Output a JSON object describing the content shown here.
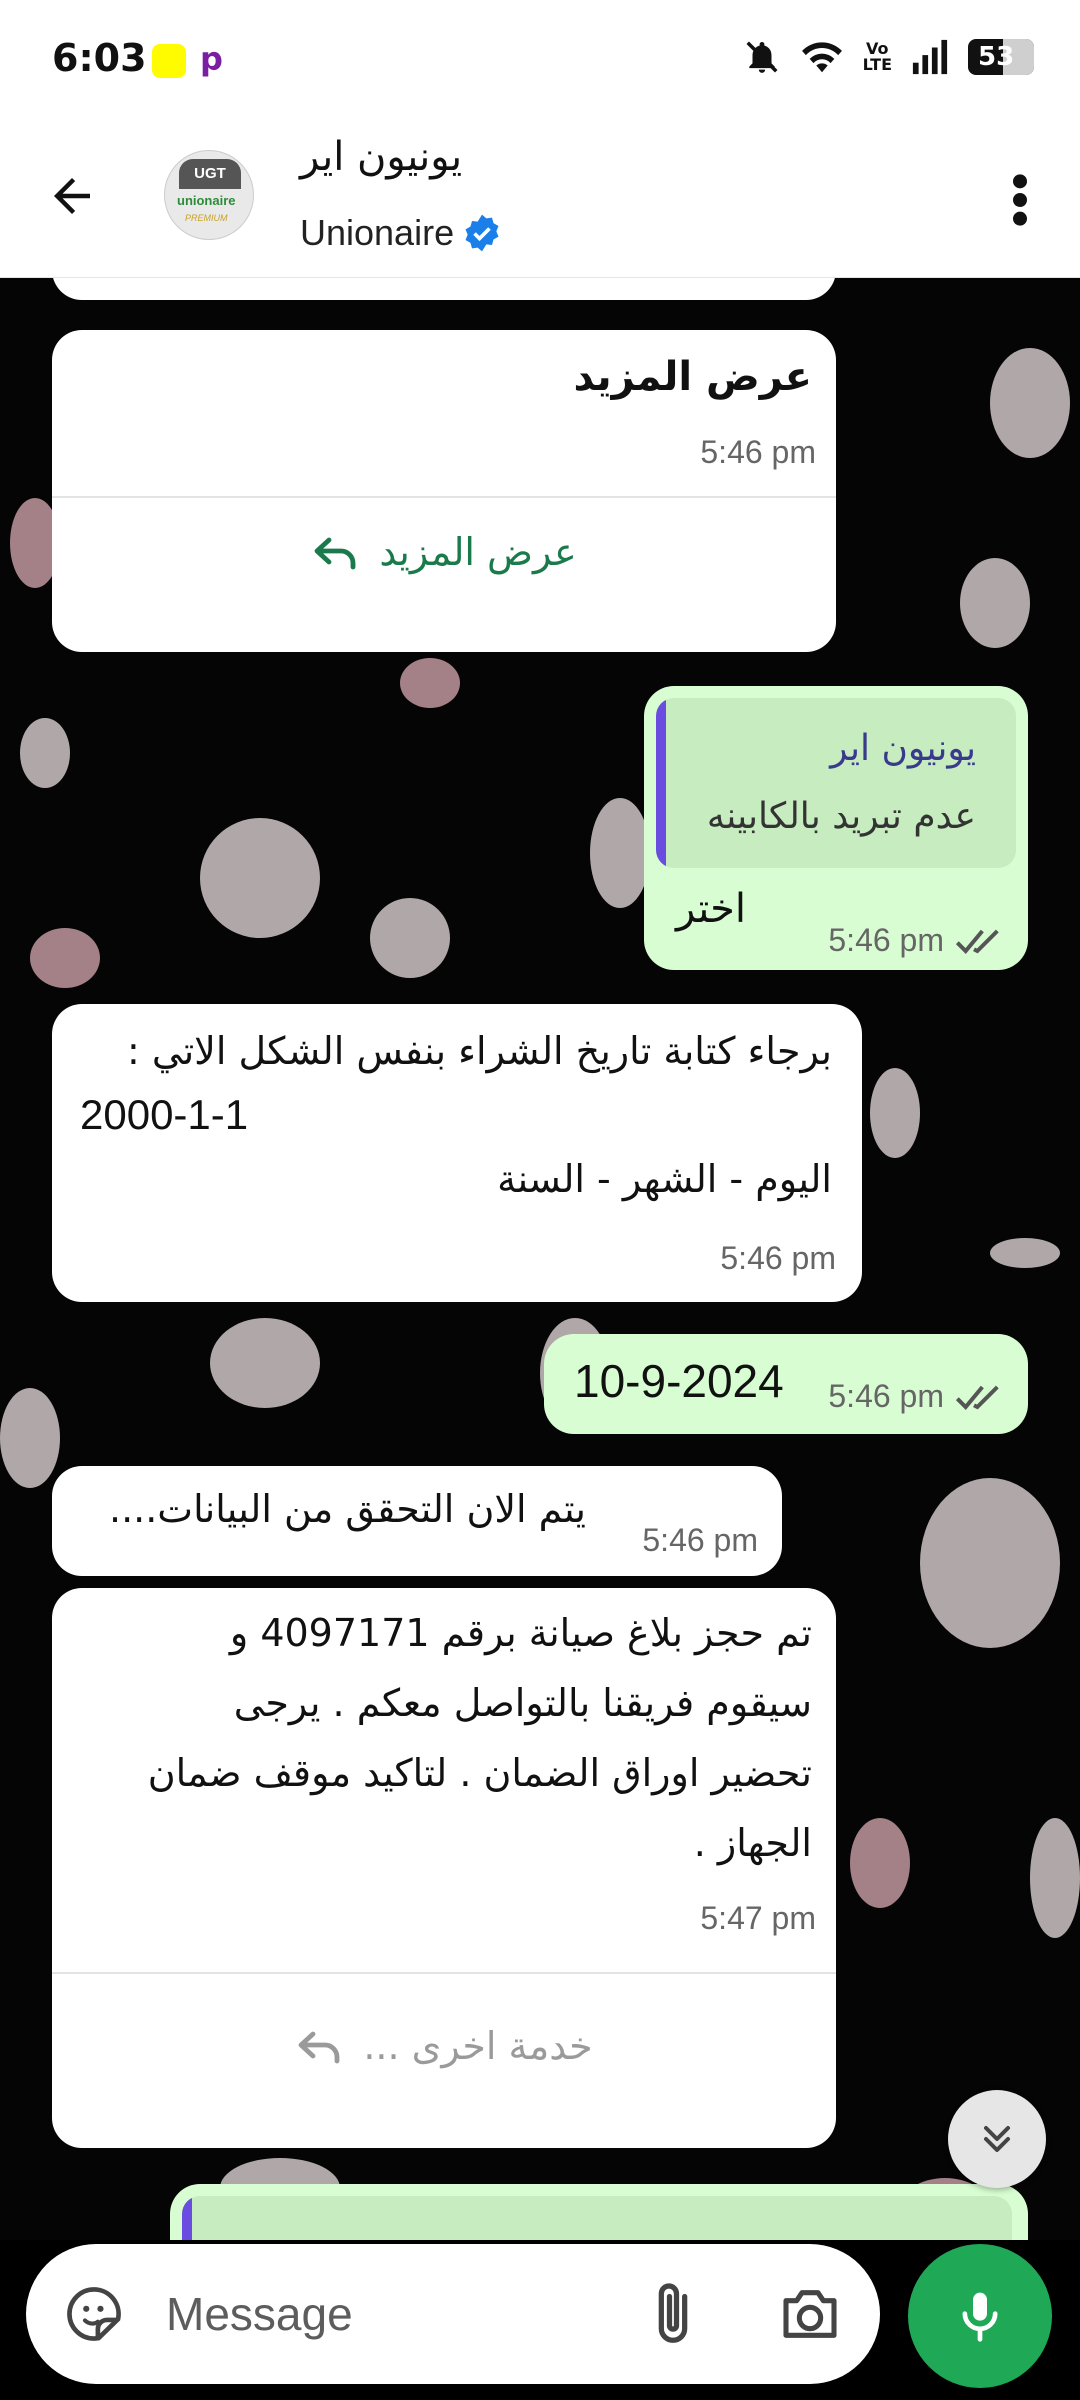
{
  "status_bar": {
    "time": "6:03",
    "battery": "53",
    "battery_level": 0.53,
    "volte": "Vo LTE"
  },
  "header": {
    "contact_name": "يونيون اير",
    "contact_sub": "Unionaire",
    "avatar_top": "UGT",
    "avatar_brand": "unionaire",
    "avatar_sub": "PREMIUM"
  },
  "messages": {
    "m1": {
      "text": "عرض المزيد",
      "time": "5:46 pm",
      "button": "عرض المزيد"
    },
    "m2": {
      "quote_title": "يونيون اير",
      "quote_text": "عدم تبريد بالكابينه",
      "text": "اختر",
      "time": "5:46 pm"
    },
    "m3": {
      "line1": "برجاء كتابة تاريخ الشراء بنفس الشكل الاتي :",
      "line2": "2000-1-1",
      "line3": "اليوم - الشهر - السنة",
      "time": "5:46 pm"
    },
    "m4": {
      "text": "10-9-2024",
      "time": "5:46 pm"
    },
    "m5": {
      "text": "يتم الان التحقق من البيانات....",
      "time": "5:46 pm"
    },
    "m6": {
      "line1": "تم حجز بلاغ صيانة برقم 4097171 و",
      "line2": "سيقوم فريقنا بالتواصل معكم . يرجى",
      "line3": "تحضير اوراق الضمان . لتاكيد موقف ضمان",
      "line4": "الجهاز .",
      "time": "5:47 pm",
      "button": "خدمة اخرى ..."
    }
  },
  "input": {
    "placeholder": "Message"
  },
  "colors": {
    "accent_green": "#1fa855",
    "outgoing_bubble": "#d8fdd2",
    "link_green": "#1b7a4b",
    "verified_blue": "#1a7fe8"
  },
  "icons": {
    "back": "back-arrow-icon",
    "more": "more-vert-icon",
    "verified": "verified-badge-icon",
    "reply": "reply-icon",
    "ticks": "double-check-icon",
    "scroll": "double-chevron-down-icon",
    "sticker": "sticker-icon",
    "attach": "paperclip-icon",
    "camera": "camera-icon",
    "mic": "mic-icon"
  }
}
